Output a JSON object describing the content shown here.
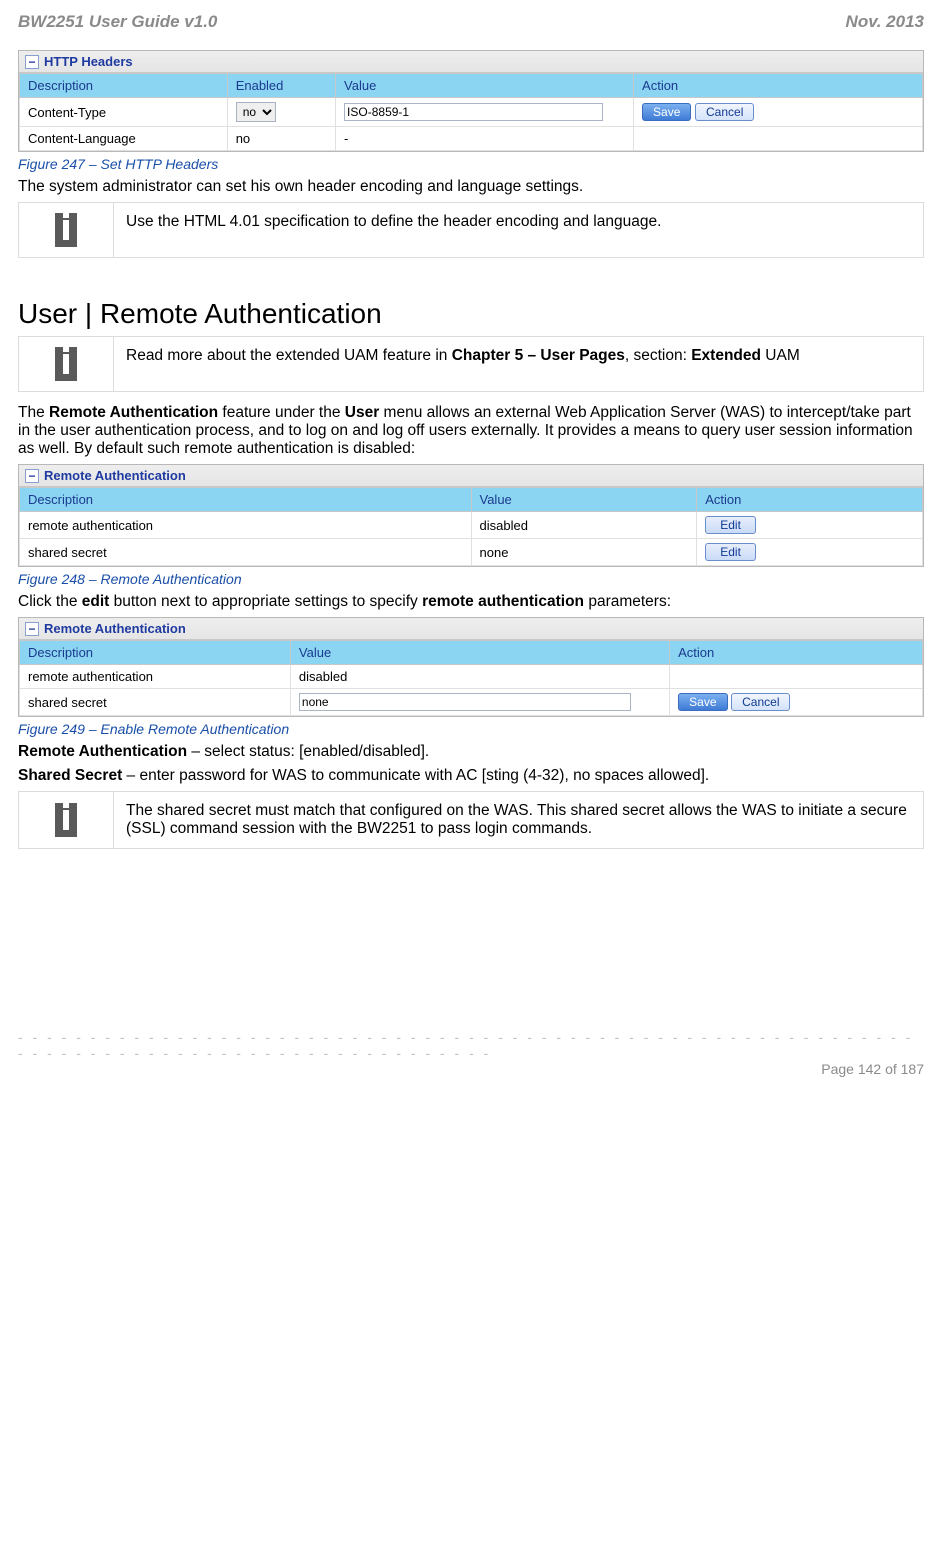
{
  "header": {
    "left": "BW2251 User Guide v1.0",
    "right": "Nov.  2013"
  },
  "http_headers_panel": {
    "title": "HTTP Headers",
    "columns": [
      "Description",
      "Enabled",
      "Value",
      "Action"
    ],
    "rows": [
      {
        "description": "Content-Type",
        "enabled": "no",
        "value": "ISO-8859-1",
        "actions": [
          "Save",
          "Cancel"
        ],
        "editable": true
      },
      {
        "description": "Content-Language",
        "enabled": "no",
        "value": "-",
        "actions": [],
        "editable": false
      }
    ]
  },
  "fig247": "Figure 247  – Set HTTP Headers",
  "text_after_247": "The system administrator can set his own header encoding and language settings.",
  "info1": "Use the HTML 4.01 specification to define the header encoding and language.",
  "section_title": "User | Remote Authentication",
  "info2_prefix": "Read more about the extended UAM feature in ",
  "info2_bold": "Chapter 5 – User Pages",
  "info2_mid": ", section: ",
  "info2_bold2": "Extended",
  "info2_tail": " UAM",
  "para_remote_1a": "The ",
  "para_remote_1b": "Remote Authentication",
  "para_remote_1c": " feature under the ",
  "para_remote_1d": "User",
  "para_remote_1e": " menu allows an external Web Application Server (WAS) to intercept/take part in the user authentication process, and to log on and log off users externally. It provides a means to query user session information as well. By default such remote authentication is disabled:",
  "remote_panel1": {
    "title": "Remote Authentication",
    "columns": [
      "Description",
      "Value",
      "Action"
    ],
    "rows": [
      {
        "description": "remote authentication",
        "value": "disabled",
        "action": "Edit"
      },
      {
        "description": "shared secret",
        "value": "none",
        "action": "Edit"
      }
    ]
  },
  "fig248": "Figure 248  – Remote Authentication",
  "text_after_248a": "Click the ",
  "text_after_248b": "edit",
  "text_after_248c": " button next to appropriate settings to specify ",
  "text_after_248d": "remote authentication",
  "text_after_248e": " parameters:",
  "remote_panel2": {
    "title": "Remote Authentication",
    "columns": [
      "Description",
      "Value",
      "Action"
    ],
    "rows": [
      {
        "description": "remote authentication",
        "value": "disabled",
        "actions": []
      },
      {
        "description": "shared secret",
        "value": "none",
        "actions": [
          "Save",
          "Cancel"
        ],
        "editable": true
      }
    ]
  },
  "fig249": "Figure 249 – Enable Remote Authentication",
  "line_ra_a": "Remote Authentication",
  "line_ra_b": " – select status: [enabled/disabled].",
  "line_ss_a": "Shared Secret",
  "line_ss_b": " – enter password for WAS to communicate with AC [sting (4-32), no spaces allowed].",
  "info3": "The shared secret must match that configured on the WAS.  This shared secret allows the WAS to initiate a secure (SSL) command session with the BW2251 to pass login commands.",
  "footer": "Page 142 of 187"
}
